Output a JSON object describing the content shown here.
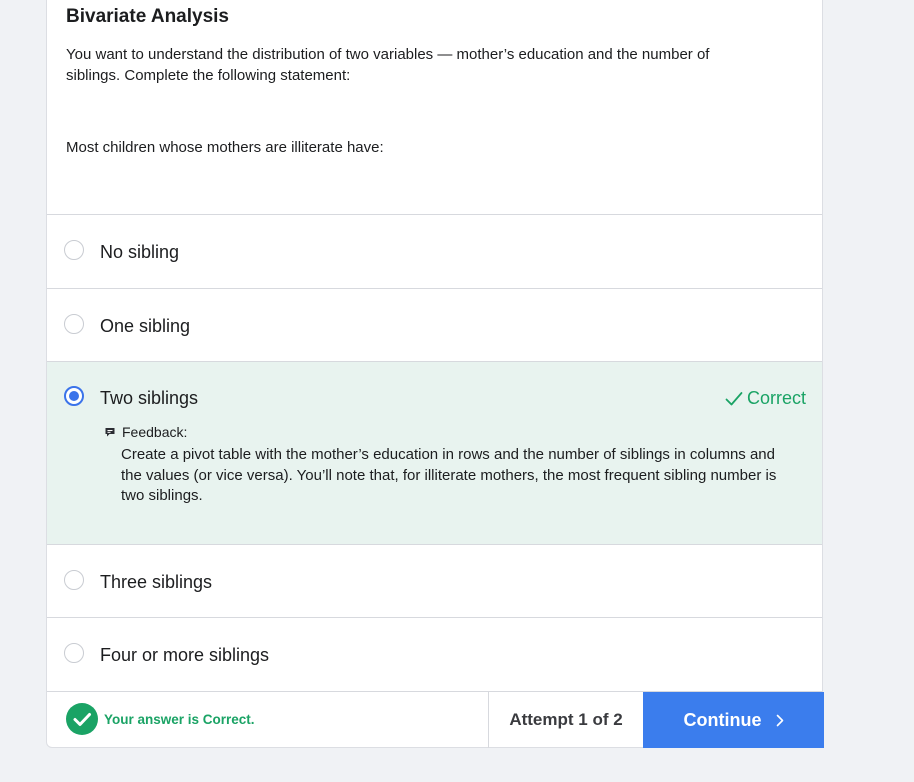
{
  "question": {
    "title": "Bivariate Analysis",
    "prompt": "You want to understand the distribution of two variables — mother’s education and the number of siblings. Complete the following statement:",
    "statement": "Most children whose mothers are illiterate have:"
  },
  "options": [
    {
      "label": "No sibling",
      "selected": false
    },
    {
      "label": "One sibling",
      "selected": false
    },
    {
      "label": "Two siblings",
      "selected": true,
      "result": "Correct",
      "feedback_label": "Feedback:",
      "feedback_text": "Create a pivot table with the mother’s education in rows and the number of siblings in columns and the values (or vice versa). You’ll note that, for illiterate mothers, the most frequent sibling number is two siblings."
    },
    {
      "label": "Three siblings",
      "selected": false
    },
    {
      "label": "Four or more siblings",
      "selected": false
    }
  ],
  "footer": {
    "status_text": "Your answer is Correct.",
    "attempt_text": "Attempt 1 of 2",
    "continue_label": "Continue"
  },
  "colors": {
    "accent_blue": "#3b7ded",
    "correct_green": "#1aa365",
    "selected_background": "#e8f3ef",
    "page_background": "#f0f2f5"
  },
  "icons": {
    "correct": "check-icon",
    "feedback": "comment-icon",
    "status": "check-circle-icon",
    "continue": "chevron-right-icon"
  }
}
